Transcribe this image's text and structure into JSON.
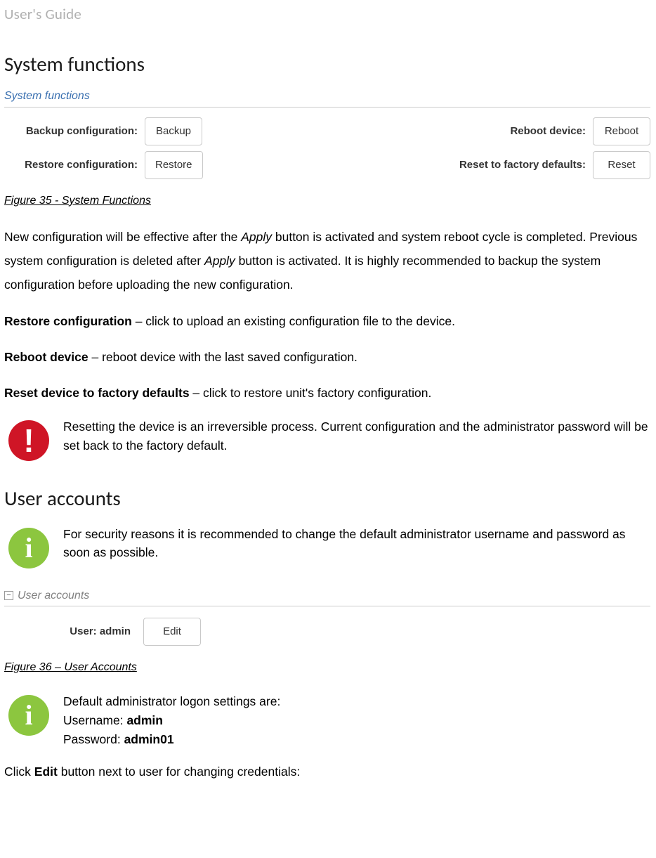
{
  "header": "User's Guide",
  "section1": {
    "title": "System functions",
    "panel_title": "System functions",
    "rows": [
      {
        "l_label": "Backup configuration:",
        "l_btn": "Backup",
        "r_label": "Reboot device:",
        "r_btn": "Reboot"
      },
      {
        "l_label": "Restore configuration:",
        "l_btn": "Restore",
        "r_label": "Reset to factory defaults:",
        "r_btn": "Reset"
      }
    ],
    "figure": "Figure 35 - System Functions",
    "paragraph_pre": "New configuration will be effective after the ",
    "apply1": "Apply",
    "paragraph_mid": " button is activated and system reboot cycle is completed. Previous system configuration is deleted after ",
    "apply2": "Apply",
    "paragraph_post": " button is activated. It is highly recommended to backup the system configuration before uploading the new configuration.",
    "restore_b": "Restore configuration",
    "restore_t": " – click to upload an existing configuration file to the device.",
    "reboot_b": "Reboot device",
    "reboot_t": " – reboot device with the last saved configuration.",
    "reset_b": "Reset device to factory defaults",
    "reset_t": " – click to restore unit's factory configuration.",
    "warn_text": "Resetting the device is an irreversible process. Current configuration and the administrator password will be set back to the factory default."
  },
  "section2": {
    "title": "User accounts",
    "info_text": "For security reasons it is recommended to change the default administrator username and password as soon as possible.",
    "panel_title": "User accounts",
    "user_label": "User: admin",
    "edit_btn": "Edit",
    "figure": "Figure 36 – User Accounts",
    "cred_intro": "Default administrator logon settings are:",
    "cred_user_l": "Username: ",
    "cred_user_v": "admin",
    "cred_pass_l": "Password:  ",
    "cred_pass_v": "admin01",
    "final_pre": "Click ",
    "final_b": "Edit",
    "final_post": " button next to user for changing credentials:"
  }
}
